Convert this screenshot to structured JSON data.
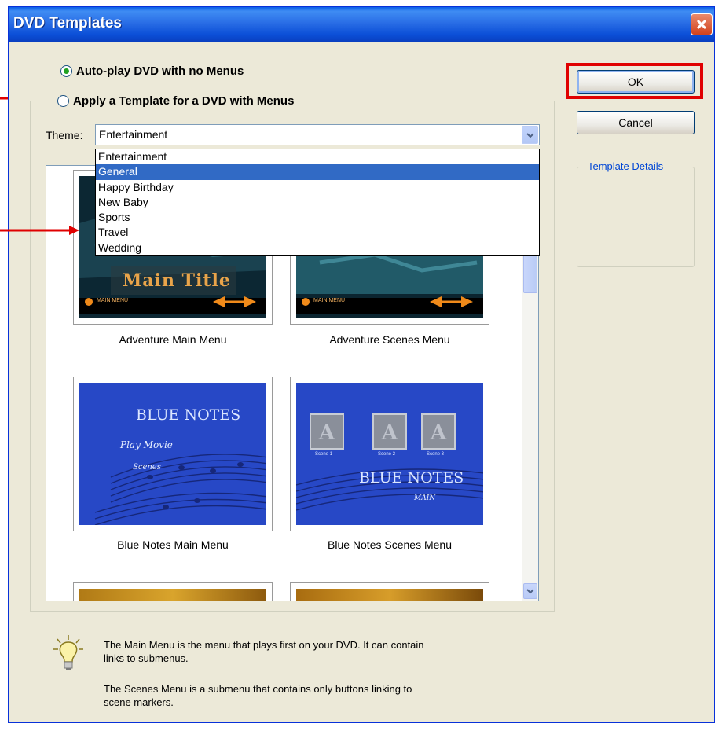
{
  "window": {
    "title": "DVD Templates"
  },
  "options": {
    "autoplay_label": "Auto-play DVD with no Menus",
    "apply_template_label": "Apply a Template for a DVD with Menus",
    "selected": "autoplay"
  },
  "theme": {
    "label": "Theme:",
    "value": "Entertainment",
    "dropdown_items": [
      "Entertainment",
      "General",
      "Happy Birthday",
      "New Baby",
      "Sports",
      "Travel",
      "Wedding"
    ],
    "highlighted_item": "General"
  },
  "templates": [
    {
      "caption": "Adventure Main Menu",
      "thumb_title": "Main Title",
      "thumb_small": "MAIN MENU"
    },
    {
      "caption": "Adventure Scenes Menu",
      "thumb_small": "MAIN MENU"
    },
    {
      "caption": "Blue Notes Main Menu",
      "thumb_title": "BLUE NOTES",
      "thumb_line1": "Play Movie",
      "thumb_line2": "Scenes"
    },
    {
      "caption": "Blue Notes Scenes Menu",
      "thumb_title": "BLUE NOTES",
      "thumb_nav": "MAIN",
      "scene_labels": [
        "Scene 1",
        "Scene 2",
        "Scene 3"
      ]
    }
  ],
  "buttons": {
    "ok": "OK",
    "cancel": "Cancel"
  },
  "details": {
    "label": "Template Details"
  },
  "help": {
    "line1": "The Main Menu is the menu that plays first on your DVD. It can contain",
    "line2": "links to submenus.",
    "line3": "The Scenes Menu is a submenu that contains only buttons linking to",
    "line4": "scene markers."
  },
  "colors": {
    "title_bar": "#0a4fd7",
    "dialog_bg": "#ece9d8",
    "selection": "#316ac5",
    "annotation": "#e00000"
  },
  "icons": [
    "close-icon",
    "chevron-down-icon",
    "lightbulb-icon",
    "arrow-right-icon"
  ]
}
